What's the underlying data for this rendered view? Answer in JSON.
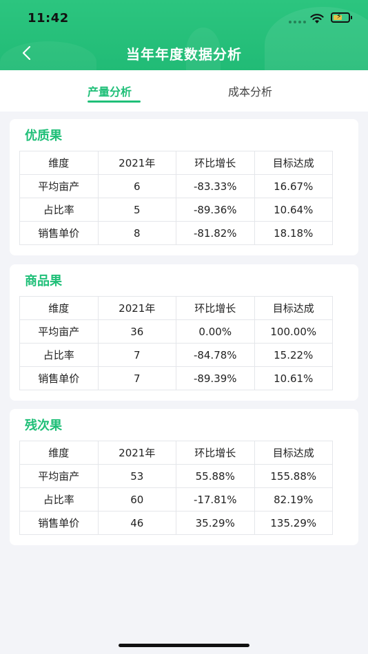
{
  "status_bar": {
    "time": "11:42"
  },
  "header": {
    "title": "当年年度数据分析"
  },
  "tabs": [
    {
      "label": "产量分析",
      "active": true
    },
    {
      "label": "成本分析",
      "active": false
    }
  ],
  "colors": {
    "accent": "#1fbf78",
    "header": "#26c07a"
  },
  "sections": [
    {
      "title": "优质果",
      "rows": [
        [
          "维度",
          "2021年",
          "环比增长",
          "目标达成"
        ],
        [
          "平均亩产",
          "6",
          "-83.33%",
          "16.67%"
        ],
        [
          "占比率",
          "5",
          "-89.36%",
          "10.64%"
        ],
        [
          "销售单价",
          "8",
          "-81.82%",
          "18.18%"
        ]
      ]
    },
    {
      "title": "商品果",
      "rows": [
        [
          "维度",
          "2021年",
          "环比增长",
          "目标达成"
        ],
        [
          "平均亩产",
          "36",
          "0.00%",
          "100.00%"
        ],
        [
          "占比率",
          "7",
          "-84.78%",
          "15.22%"
        ],
        [
          "销售单价",
          "7",
          "-89.39%",
          "10.61%"
        ]
      ]
    },
    {
      "title": "残次果",
      "rows": [
        [
          "维度",
          "2021年",
          "环比增长",
          "目标达成"
        ],
        [
          "平均亩产",
          "53",
          "55.88%",
          "155.88%"
        ],
        [
          "占比率",
          "60",
          "-17.81%",
          "82.19%"
        ],
        [
          "销售单价",
          "46",
          "35.29%",
          "135.29%"
        ]
      ]
    }
  ]
}
